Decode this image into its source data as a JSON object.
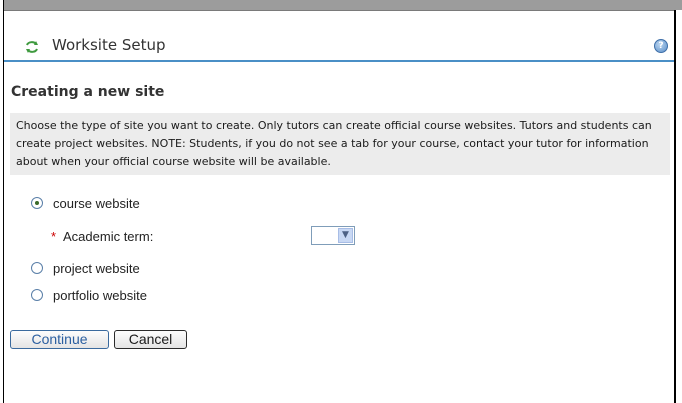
{
  "tool": {
    "title": "Worksite Setup",
    "help_glyph": "?",
    "colors": {
      "title_underline": "#4a8fc6",
      "instructions_bg": "#ececec",
      "required": "#cc0000"
    }
  },
  "page": {
    "heading": "Creating a new site",
    "instructions": "Choose the type of site you want to create. Only tutors can create official course websites. Tutors and students can create project websites. NOTE: Students, if you do not see a tab for your course, contact your tutor for information about when your official course website will be available."
  },
  "site_types": [
    {
      "label": "course website",
      "selected": true
    },
    {
      "label": "project website",
      "selected": false
    },
    {
      "label": "portfolio website",
      "selected": false
    }
  ],
  "academic_term": {
    "required_marker": "*",
    "label": "Academic term:",
    "value": ""
  },
  "buttons": {
    "continue": "Continue",
    "cancel": "Cancel"
  }
}
